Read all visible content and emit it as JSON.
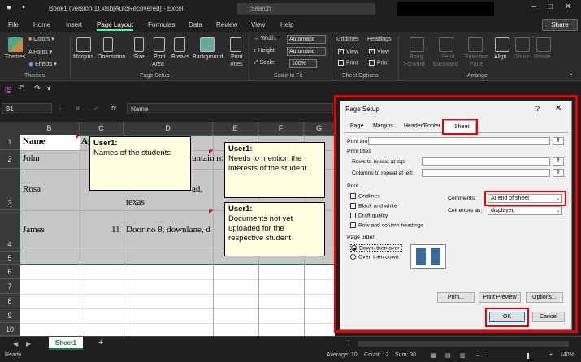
{
  "titlebar": {
    "title": "Book1 (version 1).xlsb[AutoRecovered] - Excel",
    "search_placeholder": "Search"
  },
  "menu": {
    "tabs": [
      "File",
      "Home",
      "Insert",
      "Page Layout",
      "Formulas",
      "Data",
      "Review",
      "View",
      "Help"
    ],
    "active": "Page Layout",
    "share": "Share"
  },
  "ribbon": {
    "themes": {
      "themes": "Themes",
      "colors": "Colors",
      "fonts": "Fonts",
      "effects": "Effects",
      "group": "Themes"
    },
    "page_setup": {
      "margins": "Margins",
      "orientation": "Orientation",
      "size": "Size",
      "print_area_1": "Print",
      "print_area_2": "Area",
      "breaks": "Breaks",
      "background": "Background",
      "print_titles_1": "Print",
      "print_titles_2": "Titles",
      "group": "Page Setup"
    },
    "scale": {
      "width_label": "Width:",
      "width_value": "Automatic",
      "height_label": "Height:",
      "height_value": "Automatic",
      "scale_label": "Scale:",
      "scale_value": "100%",
      "group": "Scale to Fit"
    },
    "sheet_options": {
      "gridlines": "Gridlines",
      "headings": "Headings",
      "view": "View",
      "print": "Print",
      "group": "Sheet Options"
    },
    "arrange": {
      "bring_1": "Bring",
      "bring_2": "Forward",
      "send_1": "Send",
      "send_2": "Backward",
      "selection_1": "Selection",
      "selection_2": "Pane",
      "align": "Align",
      "group_btn": "Group",
      "rotate": "Rotate",
      "group": "Arrange"
    }
  },
  "formula_bar": {
    "name_box": "B1",
    "fx": "fx",
    "content": "Name"
  },
  "sheet": {
    "columns": [
      "B",
      "C",
      "D",
      "E",
      "F",
      "G"
    ],
    "rows": [
      "1",
      "2",
      "3",
      "4",
      "5",
      "6",
      "7",
      "8",
      "9",
      "10"
    ],
    "cells": {
      "b1": "Name",
      "c1": "Ag",
      "b2": "John",
      "d2": "untain ro",
      "b3": "Rosa",
      "d3a": "ad,",
      "d3b": "texas",
      "b4": "James",
      "c4": "11",
      "d4": "Door no 8, downlane, d"
    },
    "notes": [
      {
        "author": "User1:",
        "text": "Names of the students"
      },
      {
        "author": "User1:",
        "text": "Needs to mention the interests of the student"
      },
      {
        "author": "User1:",
        "text": "Documents not yet uploaded for the respective student"
      }
    ]
  },
  "dialog": {
    "title": "Page Setup",
    "help": "?",
    "close": "✕",
    "tabs": [
      "Page",
      "Margins",
      "Header/Footer",
      "Sheet"
    ],
    "active_tab": "Sheet",
    "print_area": "Print area:",
    "print_titles": "Print titles",
    "rows_repeat": "Rows to repeat at top:",
    "cols_repeat": "Columns to repeat at left:",
    "print_section": "Print",
    "gridlines": "Gridlines",
    "black_white": "Black and white",
    "draft": "Draft quality",
    "row_col_headings": "Row and column headings",
    "comments_label": "Comments:",
    "comments_value": "At end of sheet",
    "errors_label": "Cell errors as:",
    "errors_value": "displayed",
    "page_order": "Page order",
    "down_over": "Down, then over",
    "over_down": "Over, then down",
    "print_btn": "Print...",
    "preview_btn": "Print Preview",
    "options_btn": "Options...",
    "ok": "OK",
    "cancel": "Cancel"
  },
  "sheet_tabs": {
    "active": "Sheet1",
    "add": "+"
  },
  "status": {
    "ready": "Ready",
    "average": "Average: 10",
    "count": "Count: 12",
    "sum": "Sum: 30",
    "zoom": "140%"
  }
}
